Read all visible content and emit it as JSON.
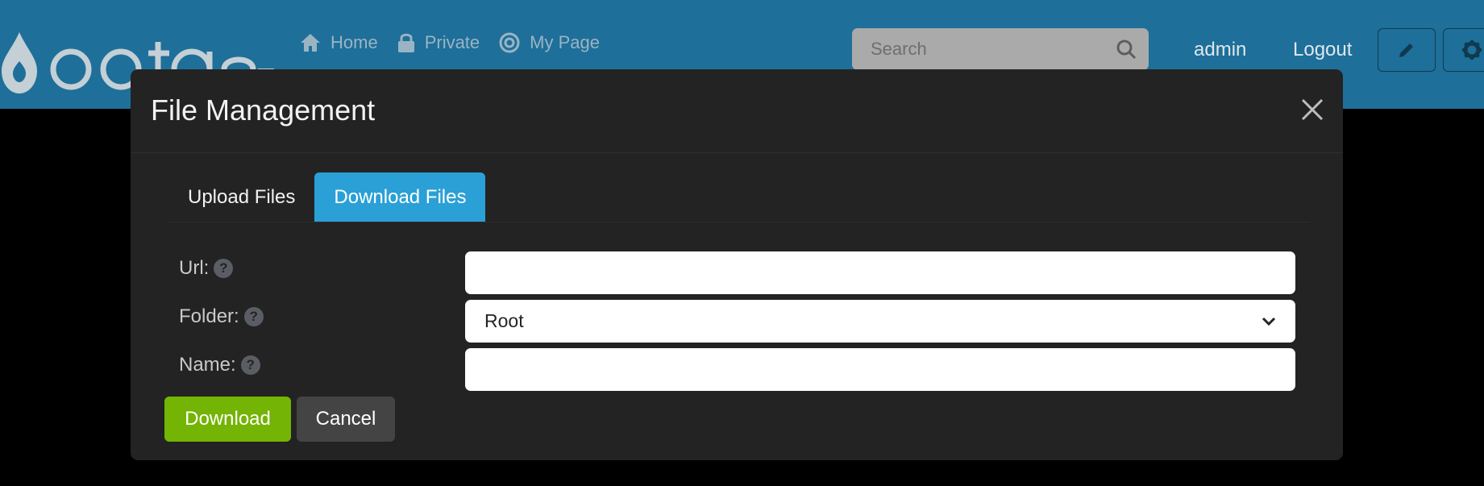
{
  "header": {
    "nav": [
      {
        "label": "Home",
        "icon": "home-icon"
      },
      {
        "label": "Private",
        "icon": "lock-icon"
      },
      {
        "label": "My Page",
        "icon": "target-icon"
      }
    ],
    "search": {
      "placeholder": "Search",
      "value": ""
    },
    "user": "admin",
    "logout": "Logout",
    "colors": {
      "bar": "#1e6f99"
    }
  },
  "modal": {
    "title": "File Management",
    "tabs": [
      {
        "label": "Upload Files",
        "active": false
      },
      {
        "label": "Download Files",
        "active": true
      }
    ],
    "fields": {
      "url": {
        "label": "Url:",
        "value": ""
      },
      "folder": {
        "label": "Folder:",
        "value": "Root"
      },
      "name": {
        "label": "Name:",
        "value": ""
      }
    },
    "buttons": {
      "download": "Download",
      "cancel": "Cancel"
    },
    "colors": {
      "tab_active": "#2aa0d6",
      "download": "#74b404",
      "cancel": "#444444"
    }
  }
}
